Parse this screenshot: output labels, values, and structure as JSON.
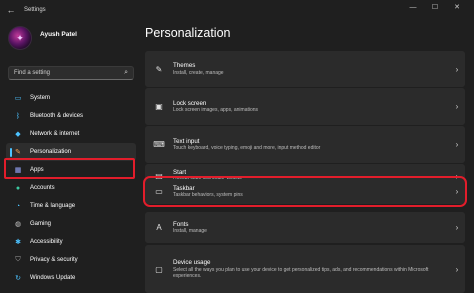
{
  "window": {
    "title": "Settings",
    "back_glyph": "←",
    "minimize": "—",
    "maximize": "☐",
    "close": "✕"
  },
  "profile": {
    "name": "Ayush Patel"
  },
  "search": {
    "placeholder": "Find a setting"
  },
  "sidebar": {
    "items": [
      {
        "label": "System",
        "icon": "monitor-icon"
      },
      {
        "label": "Bluetooth & devices",
        "icon": "bluetooth-icon"
      },
      {
        "label": "Network & internet",
        "icon": "wifi-icon"
      },
      {
        "label": "Personalization",
        "icon": "brush-icon"
      },
      {
        "label": "Apps",
        "icon": "apps-icon"
      },
      {
        "label": "Accounts",
        "icon": "person-icon"
      },
      {
        "label": "Time & language",
        "icon": "globe-clock-icon"
      },
      {
        "label": "Gaming",
        "icon": "gamepad-icon"
      },
      {
        "label": "Accessibility",
        "icon": "accessibility-icon"
      },
      {
        "label": "Privacy & security",
        "icon": "shield-icon"
      },
      {
        "label": "Windows Update",
        "icon": "update-icon"
      }
    ]
  },
  "main": {
    "title": "Personalization",
    "cards": [
      {
        "title": "Themes",
        "subtitle": "Install, create, manage",
        "icon": "brush-icon"
      },
      {
        "title": "Lock screen",
        "subtitle": "Lock screen images, apps, animations",
        "icon": "lock-screen-icon"
      },
      {
        "title": "Text input",
        "subtitle": "Touch keyboard, voice typing, emoji and more, input method editor",
        "icon": "keyboard-icon"
      },
      {
        "title": "Start",
        "subtitle": "Recent apps and items, folders",
        "icon": "start-icon"
      },
      {
        "title": "Taskbar",
        "subtitle": "Taskbar behaviors, system pins",
        "icon": "taskbar-icon"
      },
      {
        "title": "Fonts",
        "subtitle": "Install, manage",
        "icon": "fonts-icon"
      },
      {
        "title": "Device usage",
        "subtitle": "Select all the ways you plan to use your device to get personalized tips, ads, and recommendations within Microsoft experiences.",
        "icon": "device-usage-icon"
      }
    ]
  },
  "colors": {
    "accent": "#4cc2ff",
    "highlight": "#e21d2b",
    "background": "#1f1f1f",
    "card": "#2b2b2b"
  }
}
